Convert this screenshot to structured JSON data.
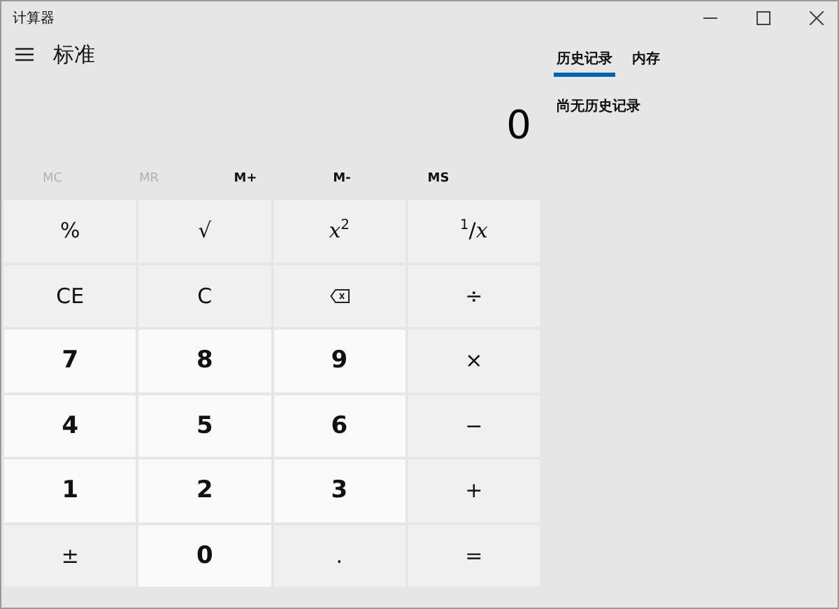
{
  "window": {
    "title": "计算器"
  },
  "mode": {
    "title": "标准"
  },
  "display": {
    "value": "0"
  },
  "memory": [
    {
      "label": "MC",
      "disabled": true
    },
    {
      "label": "MR",
      "disabled": true
    },
    {
      "label": "M+",
      "disabled": false
    },
    {
      "label": "M-",
      "disabled": false
    },
    {
      "label": "MS",
      "disabled": false
    }
  ],
  "keys": [
    {
      "kind": "op",
      "label": "%"
    },
    {
      "kind": "op",
      "label": "√"
    },
    {
      "kind": "op",
      "label": "*x*$^{2}$"
    },
    {
      "kind": "op",
      "label": "$^{1}$/*x*"
    },
    {
      "kind": "op",
      "label": "CE"
    },
    {
      "kind": "op",
      "label": "C"
    },
    {
      "kind": "backspace"
    },
    {
      "kind": "op",
      "label": "÷"
    },
    {
      "kind": "digit",
      "label": "7"
    },
    {
      "kind": "digit",
      "label": "8"
    },
    {
      "kind": "digit",
      "label": "9"
    },
    {
      "kind": "op",
      "label": "×"
    },
    {
      "kind": "digit",
      "label": "4"
    },
    {
      "kind": "digit",
      "label": "5"
    },
    {
      "kind": "digit",
      "label": "6"
    },
    {
      "kind": "op",
      "label": "−"
    },
    {
      "kind": "digit",
      "label": "1"
    },
    {
      "kind": "digit",
      "label": "2"
    },
    {
      "kind": "digit",
      "label": "3"
    },
    {
      "kind": "op",
      "label": "+"
    },
    {
      "kind": "op",
      "label": "±"
    },
    {
      "kind": "digit",
      "label": "0"
    },
    {
      "kind": "op",
      "label": "."
    },
    {
      "kind": "op",
      "label": "="
    }
  ],
  "tabs": [
    {
      "label": "历史记录",
      "selected": true
    },
    {
      "label": "内存",
      "selected": false
    }
  ],
  "history": {
    "empty_message": "尚无历史记录"
  }
}
